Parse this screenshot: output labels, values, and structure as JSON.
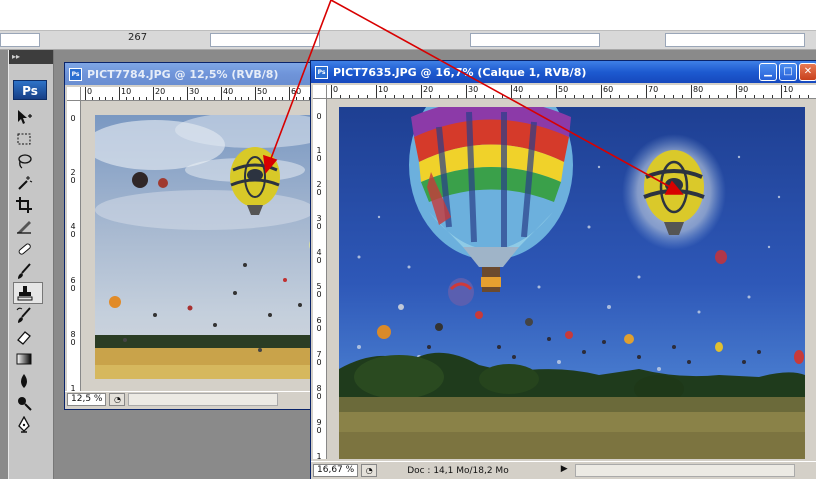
{
  "options_bar": {
    "value": "267"
  },
  "toolbox": {
    "logo": "Ps",
    "tools": [
      "move-tool",
      "marquee-tool",
      "lasso-tool",
      "magic-wand-tool",
      "crop-tool",
      "slice-tool",
      "healing-brush-tool",
      "brush-tool",
      "clone-stamp-tool",
      "history-brush-tool",
      "eraser-tool",
      "gradient-tool",
      "blur-tool",
      "dodge-tool",
      "pen-tool"
    ],
    "selected_tool": "clone-stamp-tool"
  },
  "window1": {
    "title": "PICT7784.JPG @ 12,5% (RVB/8)",
    "zoom": "12,5 %",
    "ruler_h": [
      "0",
      "10",
      "20",
      "30",
      "40",
      "50",
      "60"
    ],
    "ruler_v": [
      "0",
      "2 0",
      "4 0",
      "6 0",
      "8 0",
      "1"
    ]
  },
  "window2": {
    "title": "PICT7635.JPG @ 16,7% (Calque 1, RVB/8)",
    "zoom": "16,67 %",
    "doc_info": "Doc : 14,1 Mo/18,2 Mo",
    "ruler_h": [
      "0",
      "10",
      "20",
      "30",
      "40",
      "50",
      "60",
      "70",
      "80",
      "90",
      "10"
    ],
    "ruler_v": [
      "0",
      "1 0",
      "2 0",
      "3 0",
      "4 0",
      "5 0",
      "6 0",
      "7 0",
      "8 0",
      "9 0",
      "1"
    ]
  },
  "colors": {
    "annotation_arrow": "#d80000",
    "title_active": "#1d5ad0",
    "sky": "#2e58b8"
  }
}
